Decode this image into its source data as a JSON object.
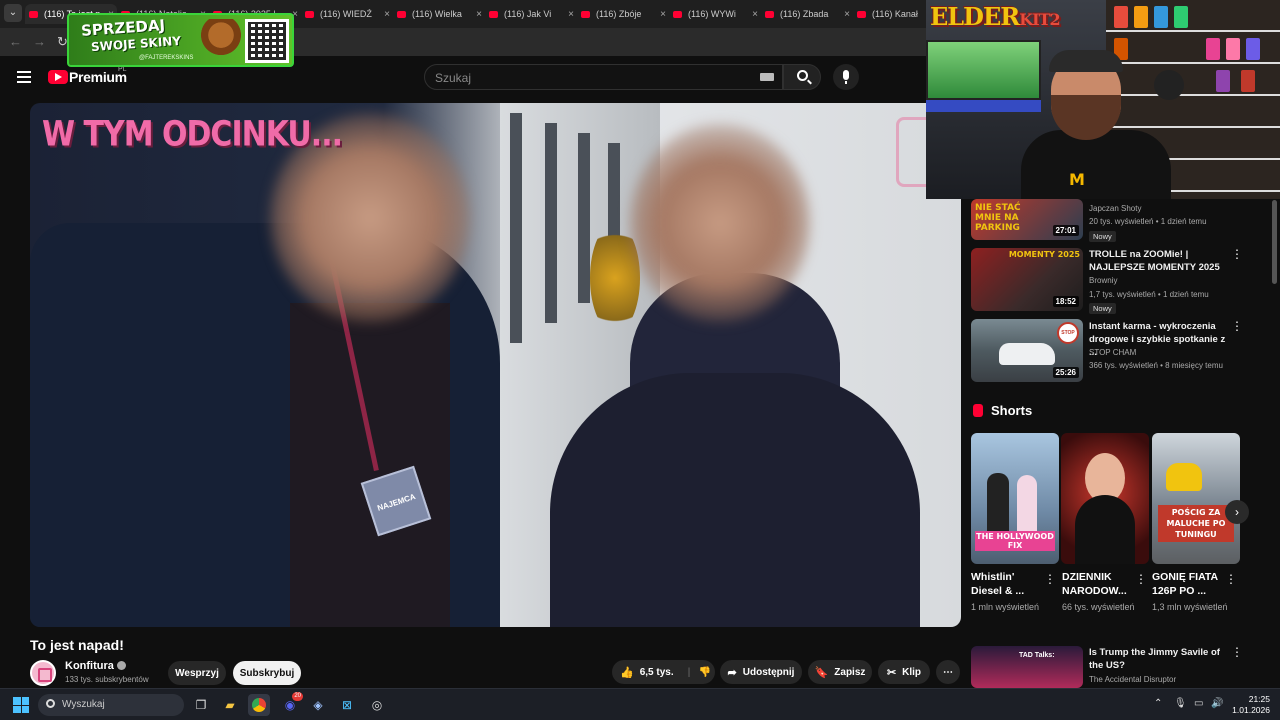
{
  "browser": {
    "tabs": [
      {
        "title": "(116) To jest n"
      },
      {
        "title": "(116) Natalia"
      },
      {
        "title": "(116) 2025 |"
      },
      {
        "title": "(116) WIEDŹ"
      },
      {
        "title": "(116) Wielka"
      },
      {
        "title": "(116) Jak Vi"
      },
      {
        "title": "(116) Zbóje"
      },
      {
        "title": "(116) WYWi"
      },
      {
        "title": "(116) Zbada"
      },
      {
        "title": "(116) Kanał"
      }
    ],
    "close_glyph": "×"
  },
  "sponsor": {
    "line1": "SPRZEDAJ",
    "line2": "SWOJE SKINY",
    "handle": "@FAJTEREKSKINS"
  },
  "youtube": {
    "logo_text": "Premium",
    "region": "PL",
    "search_placeholder": "Szukaj"
  },
  "video": {
    "overlay_text": "W TYM ODCINKU...",
    "badge_text": "NAJEMCA",
    "title": "To jest napad!",
    "channel": "Konfitura",
    "subscribers": "133 tys. subskrybentów",
    "support_label": "Wesprzyj",
    "subscribe_label": "Subskrybuj",
    "likes": "6,5 tys.",
    "share_label": "Udostępnij",
    "save_label": "Zapisz",
    "clip_label": "Klip",
    "more_label": "⋯"
  },
  "webcam": {
    "logo_a": "ELDER",
    "logo_b": "KIT2"
  },
  "sidebar": {
    "items": [
      {
        "channel": "Japczan Shoty",
        "meta": "20 tys. wyświetleń • 1 dzień temu",
        "badge": "Nowy",
        "duration": "27:01",
        "thumb_text": "NIE STAĆ MNIE NA PARKING"
      },
      {
        "title": "TROLLE na ZOOMie! | NAJLEPSZE MOMENTY 2025",
        "channel": "Browniy",
        "meta": "1,7 tys. wyświetleń • 1 dzień temu",
        "badge": "Nowy",
        "duration": "18:52",
        "thumb_text": "MOMENTY 2025"
      },
      {
        "title": "Instant karma - wykroczenia drogowe i szybkie spotkanie z ...",
        "channel": "STOP CHAM",
        "meta": "366 tys. wyświetleń • 8 miesięcy temu",
        "duration": "25:26",
        "thumb_text": "STOP CHAM"
      },
      {
        "title": "Is Trump the Jimmy Savile of the US?",
        "channel": "The Accidental Disruptor",
        "thumb_text": "TAD Talks:"
      }
    ],
    "shorts_header": "Shorts",
    "shorts": [
      {
        "title": "Whistlin' Diesel & ...",
        "views": "1 mln wyświetleń",
        "caption": "THE HOLLYWOOD FIX"
      },
      {
        "title": "DZIENNIK NARODOW...",
        "views": "66 tys. wyświetleń",
        "caption": ""
      },
      {
        "title": "GONIĘ FIATA 126P PO ...",
        "views": "1,3 mln wyświetleń",
        "caption": "POŚCIG ZA MALUCHE PO TUNINGU"
      }
    ]
  },
  "taskbar": {
    "search_label": "Wyszukaj",
    "time": "21:25",
    "date": "1.01.2026",
    "discord_badge": "20"
  },
  "colors": {
    "yt_red": "#ff0033",
    "overlay_pink": "#f06ba8",
    "windows_blue": "#4cc2ff"
  }
}
